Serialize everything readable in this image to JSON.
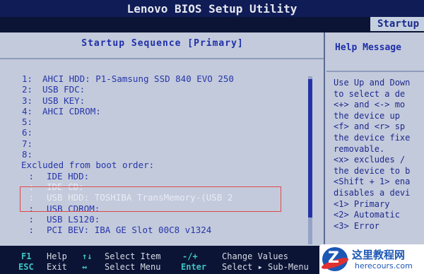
{
  "title": "Lenovo BIOS Setup Utility",
  "active_tab": "Startup",
  "section_header": "Startup Sequence  [Primary]",
  "help_header": "Help Message",
  "boot_order": [
    {
      "num": "1:",
      "device": "AHCI HDD: P1-Samsung SSD 840 EVO 250"
    },
    {
      "num": "2:",
      "device": "USB FDC:"
    },
    {
      "num": "3:",
      "device": "USB KEY:"
    },
    {
      "num": "4:",
      "device": "AHCI CDROM:"
    },
    {
      "num": "5:",
      "device": ""
    },
    {
      "num": "6:",
      "device": ""
    },
    {
      "num": "7:",
      "device": ""
    },
    {
      "num": "8:",
      "device": ""
    }
  ],
  "excluded_label": "Excluded from boot order:",
  "excluded": [
    {
      "num": ":",
      "device": "IDE HDD:"
    },
    {
      "num": ":",
      "device": "IDE CD:"
    },
    {
      "num": ":",
      "device": "USB HDD: TOSHIBA TransMemory-(USB 2"
    },
    {
      "num": ":",
      "device": "USB CDROM:"
    },
    {
      "num": ":",
      "device": "USB LS120:"
    },
    {
      "num": ":",
      "device": "PCI BEV: IBA GE Slot 00C8 v1324"
    }
  ],
  "help_lines": [
    "Use Up and Down",
    "to select a de",
    "<+> and <-> mo",
    "the device up",
    "<f> and <r> sp",
    "the device fixe",
    "removable.",
    "<x> excludes /",
    "the device to b",
    "<Shift + 1> ena",
    "disables a devi",
    "<1> Primary",
    "<2> Automatic",
    "<3> Error"
  ],
  "footer": {
    "f1_key": "F1",
    "f1_label": "Help",
    "esc_key": "ESC",
    "esc_label": "Exit",
    "updown_key": "↑↓",
    "updown_label": "Select Item",
    "lr_key": "↔",
    "lr_label": "Select Menu",
    "pm_key": "-/+",
    "pm_label": "Change Values",
    "enter_key": "Enter",
    "enter_label": "Select ▸ Sub-Menu"
  },
  "watermark": {
    "title": "这里教程网",
    "url": "herecours.com"
  },
  "colors": {
    "accent": "#2736a8",
    "background": "#c3cadc",
    "frame": "#0b1434",
    "highlight_box": "#e04848"
  }
}
